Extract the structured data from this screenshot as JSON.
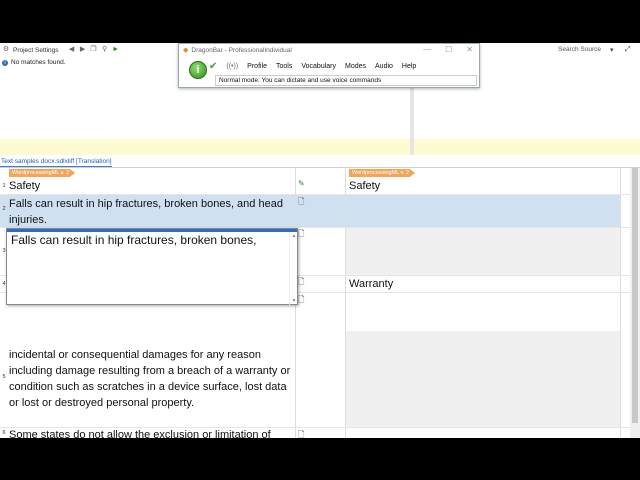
{
  "project_settings": {
    "title": "Project Settings",
    "message": "No matches found."
  },
  "search_source": "Search Source",
  "dragonbar": {
    "title": "DragonBar - ProfessionalIndividual",
    "menu": [
      "Profile",
      "Tools",
      "Vocabulary",
      "Modes",
      "Audio",
      "Help"
    ],
    "status": "Normal mode: You can dictate and use voice commands"
  },
  "tab": {
    "label": "Text samples docx.sdlxliff [Translation]"
  },
  "tags": {
    "source": "WordprocessingML v. 2",
    "target": "WordprocessingML v. 2"
  },
  "rows": [
    {
      "num": "1",
      "source": "Safety",
      "target": "Safety"
    },
    {
      "num": "2",
      "source": "Falls can result in hip fractures, broken bones, and head injuries.",
      "target": ""
    },
    {
      "num": "3",
      "source": "",
      "target": ""
    },
    {
      "num": "4",
      "source": "",
      "target": "Warranty"
    },
    {
      "num": "5",
      "source": "incidental or consequential damages for any reason including damage resulting from a breach of a warranty or condition such as scratches in a device surface, lost data or lost or destroyed personal property.",
      "target": ""
    },
    {
      "num": "6",
      "source": "Some states do not allow the exclusion or limitation of incidental or consequential damages, so the above limitation or exclusion may not apply to you.",
      "target": ""
    }
  ],
  "dictation_text": "Falls can result in hip fractures, broken bones,",
  "right_marker": "P",
  "colors": {
    "selection": "#cfe0f1",
    "tag": "#f2a65a",
    "accent": "#2d6cc0"
  }
}
